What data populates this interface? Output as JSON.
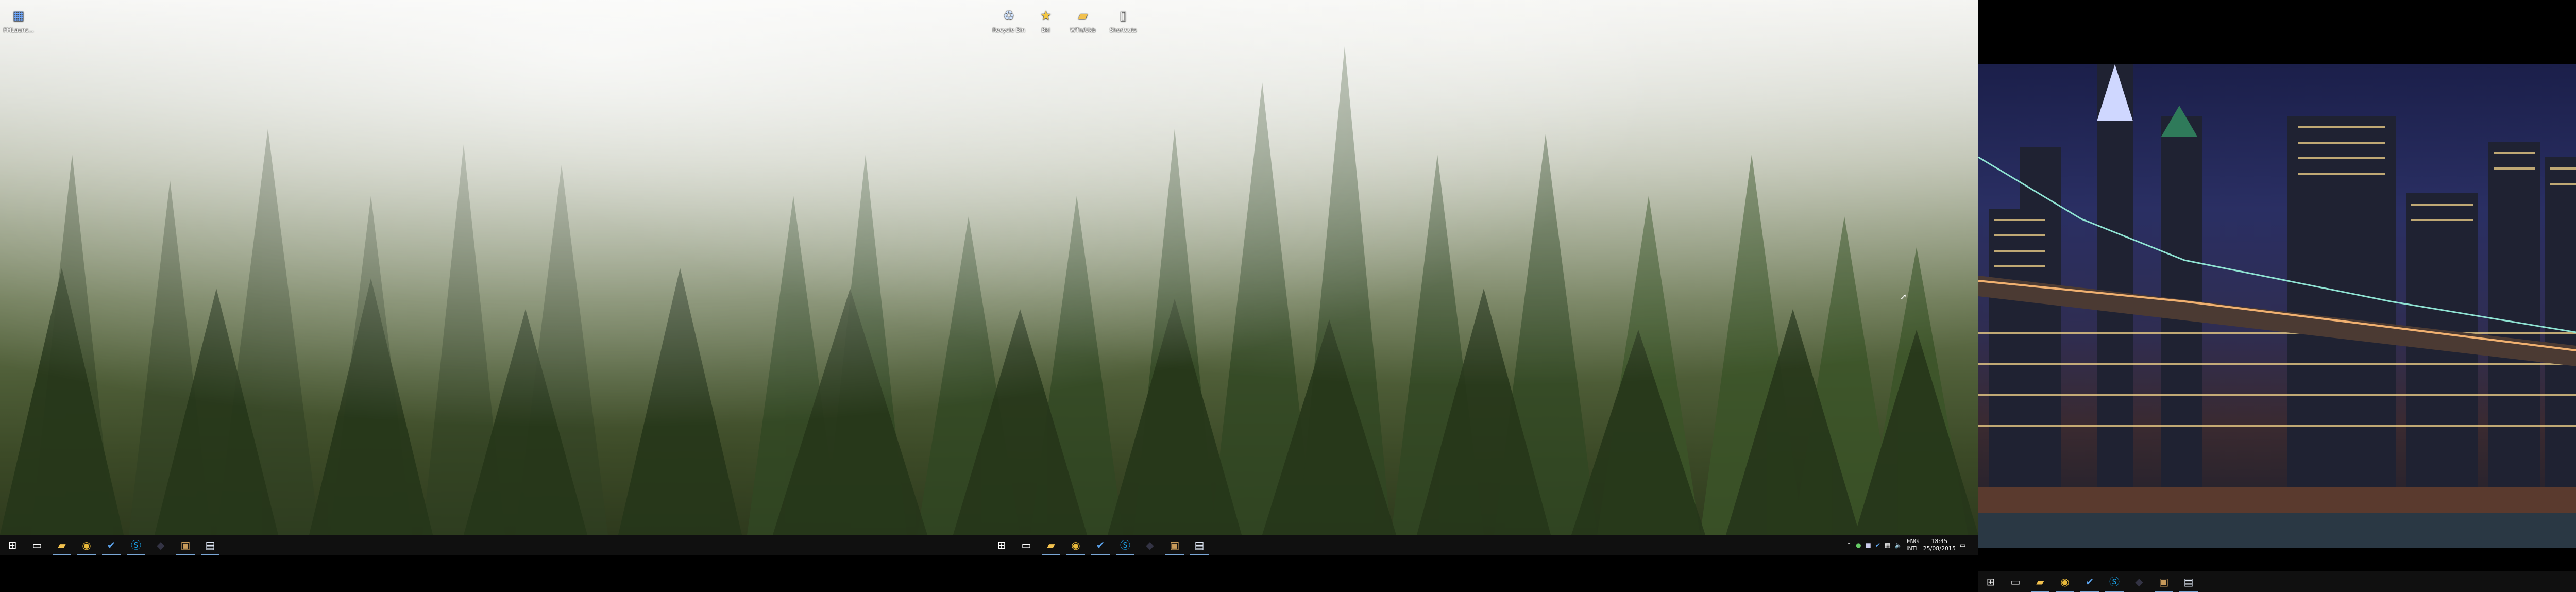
{
  "desktop_icons": [
    {
      "label": "FMLaunc...",
      "icon": "app-icon"
    },
    {
      "label": "Recycle Bin",
      "icon": "recycle-bin-icon"
    },
    {
      "label": "Bkl",
      "icon": "star-folder-icon"
    },
    {
      "label": "WTn/Ukb",
      "icon": "folder-icon"
    },
    {
      "label": "Shortcuts",
      "icon": "document-icon"
    }
  ],
  "taskbar_main": {
    "apps": [
      {
        "name": "file-explorer",
        "glyph": "📁"
      },
      {
        "name": "chrome",
        "glyph": "◉"
      },
      {
        "name": "app-check",
        "glyph": "✔"
      },
      {
        "name": "skype",
        "glyph": "S"
      },
      {
        "name": "app-dark",
        "glyph": "◆"
      },
      {
        "name": "app-box",
        "glyph": "▣"
      },
      {
        "name": "app-window",
        "glyph": "▤"
      }
    ]
  },
  "tray": {
    "language": "ENG",
    "layout": "INTL",
    "time": "18:45",
    "date": "25/08/2015"
  },
  "colors": {
    "taskbar": "#101010",
    "accent": "#7aa7d6"
  }
}
